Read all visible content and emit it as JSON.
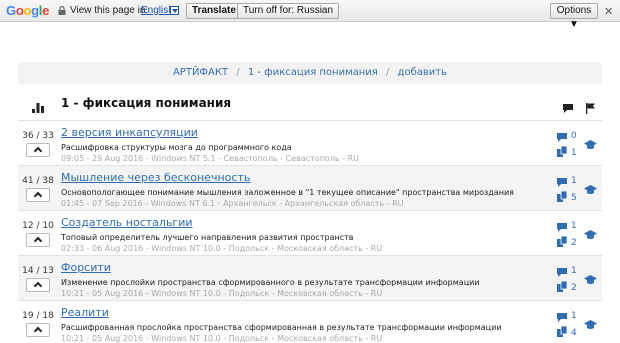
{
  "translate_bar": {
    "logo": [
      "G",
      "o",
      "o",
      "g",
      "l",
      "e"
    ],
    "logo_colors": [
      "#4285f4",
      "#ea4335",
      "#fbbc05",
      "#4285f4",
      "#34a853",
      "#ea4335"
    ],
    "prompt": "View this page in:",
    "language": "English",
    "translate_label": "Translate",
    "turn_off_label": "Turn off for: Russian",
    "options_label": "Options ▼",
    "close": "✕"
  },
  "breadcrumb": {
    "items": [
      "АРТЙФАКТ",
      "1 - фиксация понимания",
      "добавить"
    ],
    "separator": "/"
  },
  "list": {
    "title": "1 - фиксация понимания",
    "rows": [
      {
        "score": "36 / 33",
        "title": "2 версия инкапсуляции",
        "desc": "Расшифровка структуры мозга до программного кода",
        "meta": "09:05 - 29 Aug 2016 - Windows NT 5.1 - Севастополь - Севастополь - RU",
        "comments": "0",
        "docs": "1"
      },
      {
        "score": "41 / 38",
        "title": "Мышление через бесконечность",
        "desc": "Основопологающее понимание мышления заложенное в \"1 текущее описание\" пространства мироздания",
        "meta": "01:45 - 07 Sep 2016 - Windows NT 6.1 - Архангельск - Архангельская область - RU",
        "comments": "1",
        "docs": "5"
      },
      {
        "score": "12 / 10",
        "title": "Создатель ностальгии",
        "desc": "Топовый определитель лучшего направления развития пространств",
        "meta": "02:33 - 06 Aug 2016 - Windows NT 10.0 - Подольск - Московская область - RU",
        "comments": "1",
        "docs": "2"
      },
      {
        "score": "14 / 13",
        "title": "Форсити",
        "desc": "Изменение прослойки пространства сформированного в результате трансформации информации",
        "meta": "10:21 - 05 Aug 2016 - Windows NT 10.0 - Подольск - Московская область - RU",
        "comments": "1",
        "docs": "2"
      },
      {
        "score": "19 / 18",
        "title": "Реалити",
        "desc": "Расшифрованная прослойка пространства сформированная в результате трансформации информации",
        "meta": "10:21 - 05 Aug 2016 - Windows NT 10.0 - Подольск - Московская область - RU",
        "comments": "1",
        "docs": "4"
      }
    ]
  },
  "colors": {
    "link": "#2e6db4",
    "meta": "#aaaaaa",
    "row_alt": "#f4f4f4"
  }
}
